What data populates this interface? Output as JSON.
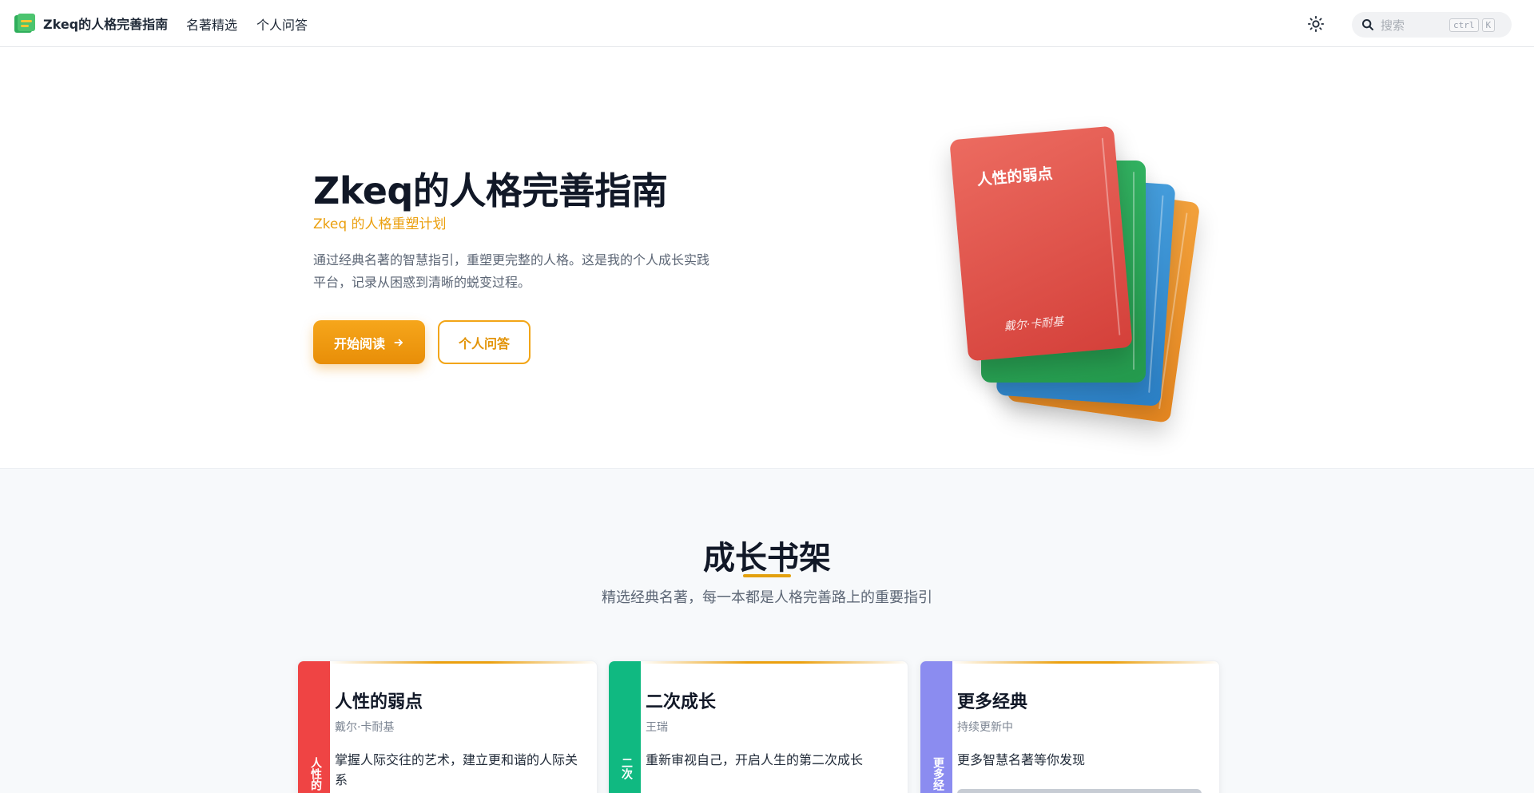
{
  "nav": {
    "brand_title": "Zkeq的人格完善指南",
    "links": [
      "名著精选",
      "个人问答"
    ],
    "theme_toggle_icon": "sun-icon",
    "search": {
      "placeholder": "搜索",
      "kbd_ctrl": "ctrl",
      "kbd_key": "K"
    }
  },
  "hero": {
    "title": "Zkeq的人格完善指南",
    "subtitle": "Zkeq 的人格重塑计划",
    "description": "通过经典名著的智慧指引，重塑更完整的人格。这是我的个人成长实践平台，记录从困惑到清晰的蜕变过程。",
    "primary_button": "开始阅读",
    "primary_button_icon": "arrow-right-icon",
    "secondary_button": "个人问答",
    "book_stack": {
      "front_title": "人性的弱点",
      "front_author": "戴尔·卡耐基",
      "colors": [
        "#e8574d",
        "#2da55a",
        "#3a92d4",
        "#ee9830"
      ]
    }
  },
  "shelf": {
    "title": "成长书架",
    "subtitle": "精选经典名著，每一本都是人格完善路上的重要指引",
    "cards": [
      {
        "title": "人性的弱点",
        "author": "戴尔·卡耐基",
        "description": "掌握人际交往的艺术，建立更和谐的人际关系",
        "spine_text": "人性的",
        "spine_color": "#ef4444"
      },
      {
        "title": "二次成长",
        "author": "王瑞",
        "description": "重新审视自己，开启人生的第二次成长",
        "spine_text": "二次",
        "spine_color": "#10b981"
      },
      {
        "title": "更多经典",
        "author": "持续更新中",
        "description": "更多智慧名著等你发现",
        "spine_text": "更多经",
        "spine_color": "#8b8cf0"
      }
    ]
  },
  "colors": {
    "accent": "#eba00f",
    "title": "#111827",
    "muted": "#5c6675"
  }
}
